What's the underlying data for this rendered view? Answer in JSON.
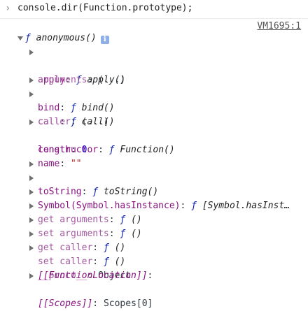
{
  "console": {
    "prompt_symbol": "›",
    "input": "console.dir(Function.prototype);",
    "source_link": "VM1695:1"
  },
  "root": {
    "fsym": "ƒ",
    "label": "anonymous()",
    "info_glyph": "i"
  },
  "rows": [
    {
      "key": "apply",
      "sep": ": ",
      "fsym": "ƒ",
      "value": "apply()"
    },
    {
      "key": "arguments",
      "sep": ": ",
      "value": "(...)"
    },
    {
      "key": "bind",
      "sep": ": ",
      "fsym": "ƒ",
      "value": "bind()"
    },
    {
      "key": "call",
      "sep": ": ",
      "fsym": "ƒ",
      "value": "call()"
    },
    {
      "key": "caller",
      "sep": ": ",
      "value": "(...)"
    },
    {
      "key": "constructor",
      "sep": ": ",
      "fsym": "ƒ",
      "value": "Function()"
    },
    {
      "key": "length",
      "sep": ": ",
      "value": "0"
    },
    {
      "key": "name",
      "sep": ": ",
      "value": "\"\""
    },
    {
      "key": "toString",
      "sep": ": ",
      "fsym": "ƒ",
      "value": "toString()"
    },
    {
      "key": "Symbol(Symbol.hasInstance)",
      "sep": ": ",
      "fsym": "ƒ",
      "value": "[Symbol.hasInst…"
    },
    {
      "key": "get arguments",
      "sep": ": ",
      "fsym": "ƒ",
      "value": "()"
    },
    {
      "key": "set arguments",
      "sep": ": ",
      "fsym": "ƒ",
      "value": "()"
    },
    {
      "key": "get caller",
      "sep": ": ",
      "fsym": "ƒ",
      "value": "()"
    },
    {
      "key": "set caller",
      "sep": ": ",
      "fsym": "ƒ",
      "value": "()"
    },
    {
      "key": "__proto__",
      "sep": ": ",
      "value": "Object"
    },
    {
      "key": "[[FunctionLocation]]",
      "sep": ":",
      "value": ""
    },
    {
      "key": "[[Scopes]]",
      "sep": ": ",
      "value": "Scopes[0]"
    }
  ]
}
